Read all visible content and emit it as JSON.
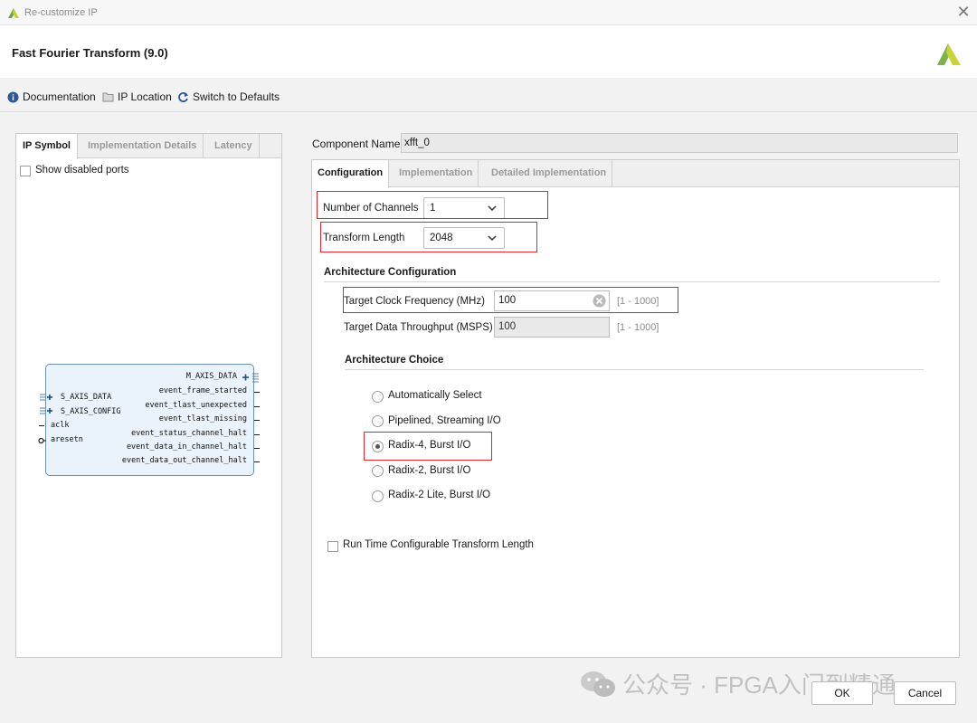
{
  "window": {
    "title": "Re-customize IP",
    "close_glyph": "✕"
  },
  "header": {
    "title": "Fast Fourier Transform (9.0)",
    "logo": "xilinx-logo"
  },
  "toolbar": {
    "documentation": "Documentation",
    "ip_location": "IP Location",
    "switch_defaults": "Switch to Defaults"
  },
  "left": {
    "tabs": [
      "IP Symbol",
      "Implementation Details",
      "Latency"
    ],
    "show_disabled_ports": "Show disabled ports",
    "symbol": {
      "left_ports": [
        "S_AXIS_DATA",
        "S_AXIS_CONFIG",
        "aclk",
        "aresetn"
      ],
      "right_ports": [
        "M_AXIS_DATA",
        "event_frame_started",
        "event_tlast_unexpected",
        "event_tlast_missing",
        "event_status_channel_halt",
        "event_data_in_channel_halt",
        "event_data_out_channel_halt"
      ]
    }
  },
  "right": {
    "component_name_label": "Component Name",
    "component_name_value": "xfft_0",
    "tabs": [
      "Configuration",
      "Implementation",
      "Detailed Implementation"
    ],
    "num_channels_label": "Number of Channels",
    "num_channels_value": "1",
    "transform_length_label": "Transform Length",
    "transform_length_value": "2048",
    "arch_config_title": "Architecture Configuration",
    "clock_freq_label": "Target Clock Frequency (MHz)",
    "clock_freq_value": "100",
    "clock_freq_range": "[1 - 1000]",
    "throughput_label": "Target Data Throughput (MSPS)",
    "throughput_value": "100",
    "throughput_range": "[1 - 1000]",
    "arch_choice_title": "Architecture Choice",
    "arch_options": [
      "Automatically Select",
      "Pipelined, Streaming I/O",
      "Radix-4, Burst I/O",
      "Radix-2, Burst I/O",
      "Radix-2 Lite, Burst I/O"
    ],
    "arch_selected": "Radix-4, Burst I/O",
    "runtime_config_label": "Run Time Configurable Transform Length"
  },
  "footer": {
    "ok": "OK",
    "cancel": "Cancel"
  },
  "watermark": {
    "text": "公众号 · FPGA入门到精通"
  },
  "colors": {
    "highlight_box": "#e4242b",
    "symbol_fill": "#eaf2fb",
    "info_icon": "#2b5a9b",
    "refresh_icon": "#2b5a9b",
    "logo_yellow": "#c7d02f",
    "logo_green": "#6aa84f"
  }
}
